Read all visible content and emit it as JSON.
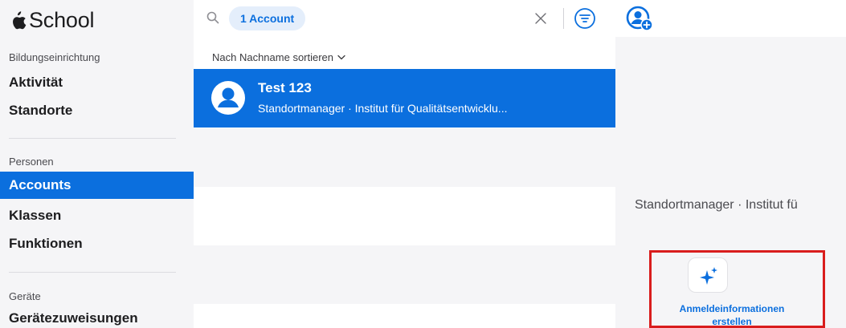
{
  "app": {
    "title": "School"
  },
  "sidebar": {
    "sections": [
      {
        "heading": "Bildungseinrichtung",
        "items": [
          "Aktivität",
          "Standorte"
        ]
      },
      {
        "heading": "Personen",
        "items": [
          "Accounts",
          "Klassen",
          "Funktionen"
        ]
      },
      {
        "heading": "Geräte",
        "items": [
          "Gerätezuweisungen"
        ]
      }
    ],
    "active_item": "Accounts"
  },
  "search": {
    "token_label": "1 Account"
  },
  "list": {
    "sort_label": "Nach Nachname sortieren",
    "rows": [
      {
        "name": "Test 123",
        "subtitle": "Standortmanager · Institut für Qualitätsentwicklu..."
      }
    ]
  },
  "detail": {
    "subtitle": "Standortmanager · Institut fü",
    "action_label_line1": "Anmeldeinformationen",
    "action_label_line2": "erstellen"
  },
  "colors": {
    "accent": "#0b6fde",
    "highlight_box": "#d91d1d",
    "sidebar_bg": "#f5f5f7"
  },
  "icons": [
    "apple-logo-icon",
    "search-icon",
    "clear-icon",
    "filter-icon",
    "chevron-down-icon",
    "person-avatar-icon",
    "add-account-icon",
    "sparkle-icon"
  ]
}
